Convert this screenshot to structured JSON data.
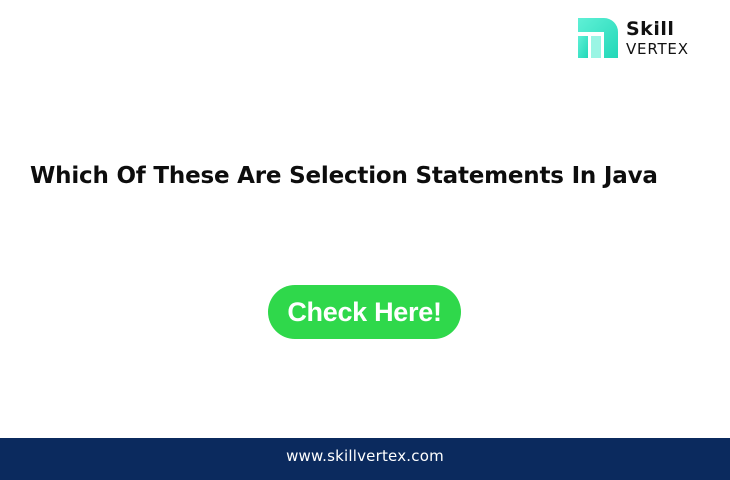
{
  "logo": {
    "word_top": "Skill",
    "word_bottom": "VERTEX",
    "icon": "skill-vertex-mark",
    "mark_color": "#3ee6c8"
  },
  "headline": {
    "text": "Which Of These Are Selection Statements In Java"
  },
  "cta": {
    "label": "Check Here!",
    "color": "#2fd84b"
  },
  "footer": {
    "url_text": "www.skillvertex.com",
    "background": "#0b2a5e"
  }
}
